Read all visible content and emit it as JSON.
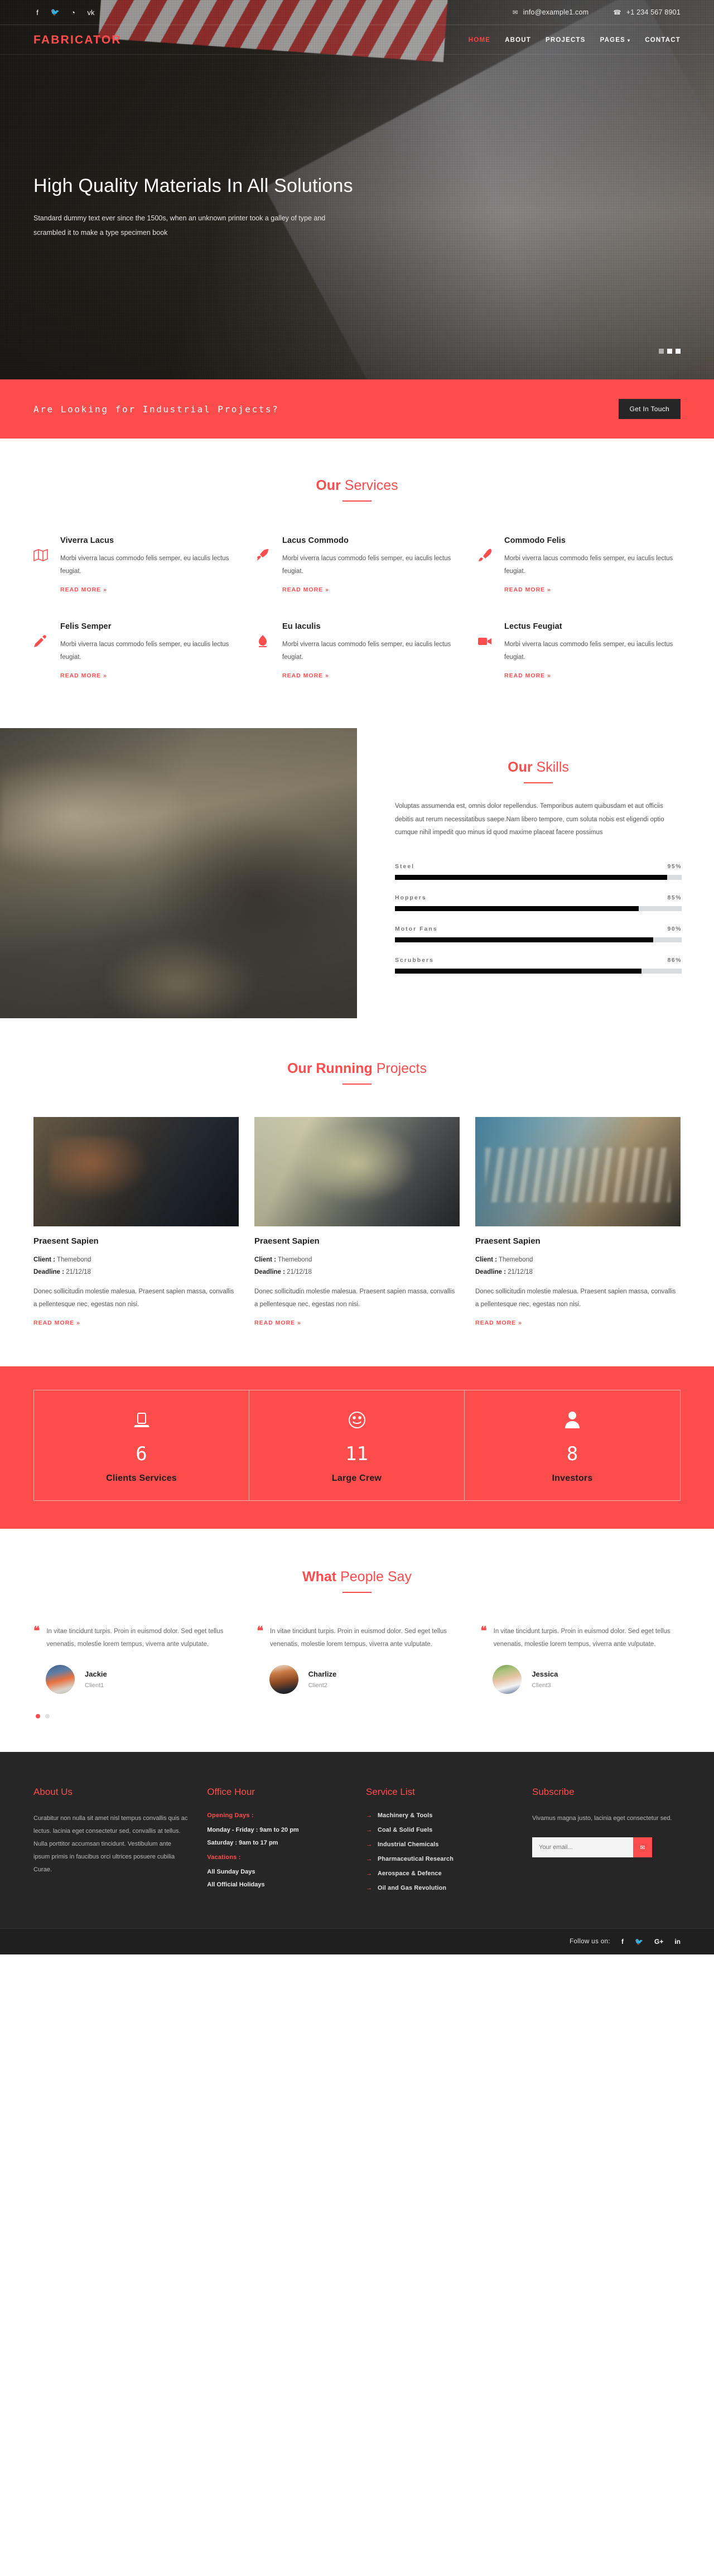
{
  "topbar": {
    "social": [
      {
        "name": "facebook",
        "glyph": "f"
      },
      {
        "name": "twitter",
        "glyph": "🐦"
      },
      {
        "name": "rss",
        "glyph": "◔"
      },
      {
        "name": "vk",
        "glyph": "vk"
      }
    ],
    "email_icon": "✉",
    "email": "info@example1.com",
    "phone_icon": "☎",
    "phone": "+1 234 567 8901"
  },
  "nav": {
    "brand": "FABRICATOR",
    "items": [
      {
        "label": "HOME",
        "active": true
      },
      {
        "label": "ABOUT",
        "active": false
      },
      {
        "label": "PROJECTS",
        "active": false
      },
      {
        "label": "PAGES",
        "active": false,
        "caret": "▾"
      },
      {
        "label": "CONTACT",
        "active": false
      }
    ]
  },
  "hero": {
    "title": "High Quality Materials In All Solutions",
    "subtitle": "Standard dummy text ever since the 1500s, when an unknown printer took a galley of type and scrambled it to make a type specimen book",
    "slides": [
      false,
      true,
      true
    ]
  },
  "cta": {
    "text": "Are Looking for Industrial Projects?",
    "button": "Get In Touch"
  },
  "services": {
    "heading_bold": "Our",
    "heading_light": "Services",
    "read_more": "READ MORE »",
    "items": [
      {
        "icon": "map-icon",
        "title": "Viverra Lacus",
        "text": "Morbi viverra lacus commodo felis semper, eu iaculis lectus feugiat."
      },
      {
        "icon": "rocket-icon",
        "title": "Lacus Commodo",
        "text": "Morbi viverra lacus commodo felis semper, eu iaculis lectus feugiat."
      },
      {
        "icon": "brush-icon",
        "title": "Commodo Felis",
        "text": "Morbi viverra lacus commodo felis semper, eu iaculis lectus feugiat."
      },
      {
        "icon": "pencil-icon",
        "title": "Felis Semper",
        "text": "Morbi viverra lacus commodo felis semper, eu iaculis lectus feugiat."
      },
      {
        "icon": "flame-icon",
        "title": "Eu Iaculis",
        "text": "Morbi viverra lacus commodo felis semper, eu iaculis lectus feugiat."
      },
      {
        "icon": "video-icon",
        "title": "Lectus Feugiat",
        "text": "Morbi viverra lacus commodo felis semper, eu iaculis lectus feugiat."
      }
    ]
  },
  "skills": {
    "heading_bold": "Our",
    "heading_light": "Skills",
    "intro": "Voluptas assumenda est, omnis dolor repellendus. Temporibus autem quibusdam et aut officiis debitis aut rerum necessitatibus saepe.Nam libero tempore, cum soluta nobis est eligendi optio cumque nihil impedit quo minus id quod maxime placeat facere possimus"
  },
  "chart_data": {
    "type": "bar",
    "title": "Our Skills",
    "categories": [
      "Steel",
      "Hoppers",
      "Motor Fans",
      "Scrubbers"
    ],
    "values": [
      95,
      85,
      90,
      86
    ],
    "value_labels": [
      "95%",
      "85%",
      "90%",
      "86%"
    ],
    "xlabel": "",
    "ylabel": "",
    "ylim": [
      0,
      100
    ],
    "orientation": "horizontal",
    "grid": false,
    "legend": false,
    "bar_color": "#050505",
    "track_color": "#d9dde0"
  },
  "projects": {
    "heading_bold": "Our Running",
    "heading_light": "Projects",
    "read_more": "READ MORE »",
    "client_label": "Client :",
    "deadline_label": "Deadline :",
    "items": [
      {
        "title": "Praesent Sapien",
        "client": "Themebond",
        "deadline": "21/12/18",
        "desc": "Donec sollicitudin molestie malesua. Praesent sapien massa, convallis a pellentesque nec, egestas non nisi."
      },
      {
        "title": "Praesent Sapien",
        "client": "Themebond",
        "deadline": "21/12/18",
        "desc": "Donec sollicitudin molestie malesua. Praesent sapien massa, convallis a pellentesque nec, egestas non nisi."
      },
      {
        "title": "Praesent Sapien",
        "client": "Themebond",
        "deadline": "21/12/18",
        "desc": "Donec sollicitudin molestie malesua. Praesent sapien massa, convallis a pellentesque nec, egestas non nisi."
      }
    ]
  },
  "counters": [
    {
      "icon": "laptop-icon",
      "value": "6",
      "label": "Clients Services"
    },
    {
      "icon": "smile-icon",
      "value": "11",
      "label": "Large Crew"
    },
    {
      "icon": "user-icon",
      "value": "8",
      "label": "Investors"
    }
  ],
  "testimonials": {
    "heading_bold": "What",
    "heading_light": "People Say",
    "quote_mark": "❝",
    "items": [
      {
        "text": "In vitae tincidunt turpis. Proin in euismod dolor. Sed eget tellus venenatis, molestie lorem tempus, viverra ante vulputate.",
        "name": "Jackie",
        "role": "Client1"
      },
      {
        "text": "In vitae tincidunt turpis. Proin in euismod dolor. Sed eget tellus venenatis, molestie lorem tempus, viverra ante vulputate.",
        "name": "Charlize",
        "role": "Client2"
      },
      {
        "text": "In vitae tincidunt turpis. Proin in euismod dolor. Sed eget tellus venenatis, molestie lorem tempus, viverra ante vulputate.",
        "name": "Jessica",
        "role": "Client3"
      }
    ],
    "dots": [
      true,
      false
    ]
  },
  "footer": {
    "about": {
      "title": "About Us",
      "text": "Curabitur non nulla sit amet nisl tempus convallis quis ac lectus. lacinia eget consectetur sed, convallis at tellus. Nulla porttitor accumsan tincidunt. Vestibulum ante ipsum primis in faucibus orci ultrices posuere cubilia Curae."
    },
    "office": {
      "title": "Office Hour",
      "opening_label": "Opening Days :",
      "lines": [
        "Monday - Friday : 9am to 20 pm",
        "Saturday : 9am to 17 pm"
      ],
      "vacation_label": "Vacations :",
      "vacation_lines": [
        "All Sunday Days",
        "All Official Holidays"
      ]
    },
    "service_list": {
      "title": "Service List",
      "arrow": "→",
      "items": [
        "Machinery & Tools",
        "Coal & Solid Fuels",
        "Industrial Chemicals",
        "Pharmaceutical Research",
        "Aerospace & Defence",
        "Oil and Gas Revolution"
      ]
    },
    "subscribe": {
      "title": "Subscribe",
      "text": "Vivamus magna justo, lacinia eget consectetur sed.",
      "placeholder": "Your email...",
      "button_icon": "✉"
    }
  },
  "bottombar": {
    "follow_label": "Follow us on:",
    "social": [
      {
        "name": "facebook",
        "glyph": "f"
      },
      {
        "name": "twitter",
        "glyph": "🐦"
      },
      {
        "name": "google-plus",
        "glyph": "G+"
      },
      {
        "name": "linkedin",
        "glyph": "in"
      }
    ]
  },
  "colors": {
    "accent": "#ff4d4d",
    "dark": "#262626",
    "darker": "#1f1f1f"
  }
}
